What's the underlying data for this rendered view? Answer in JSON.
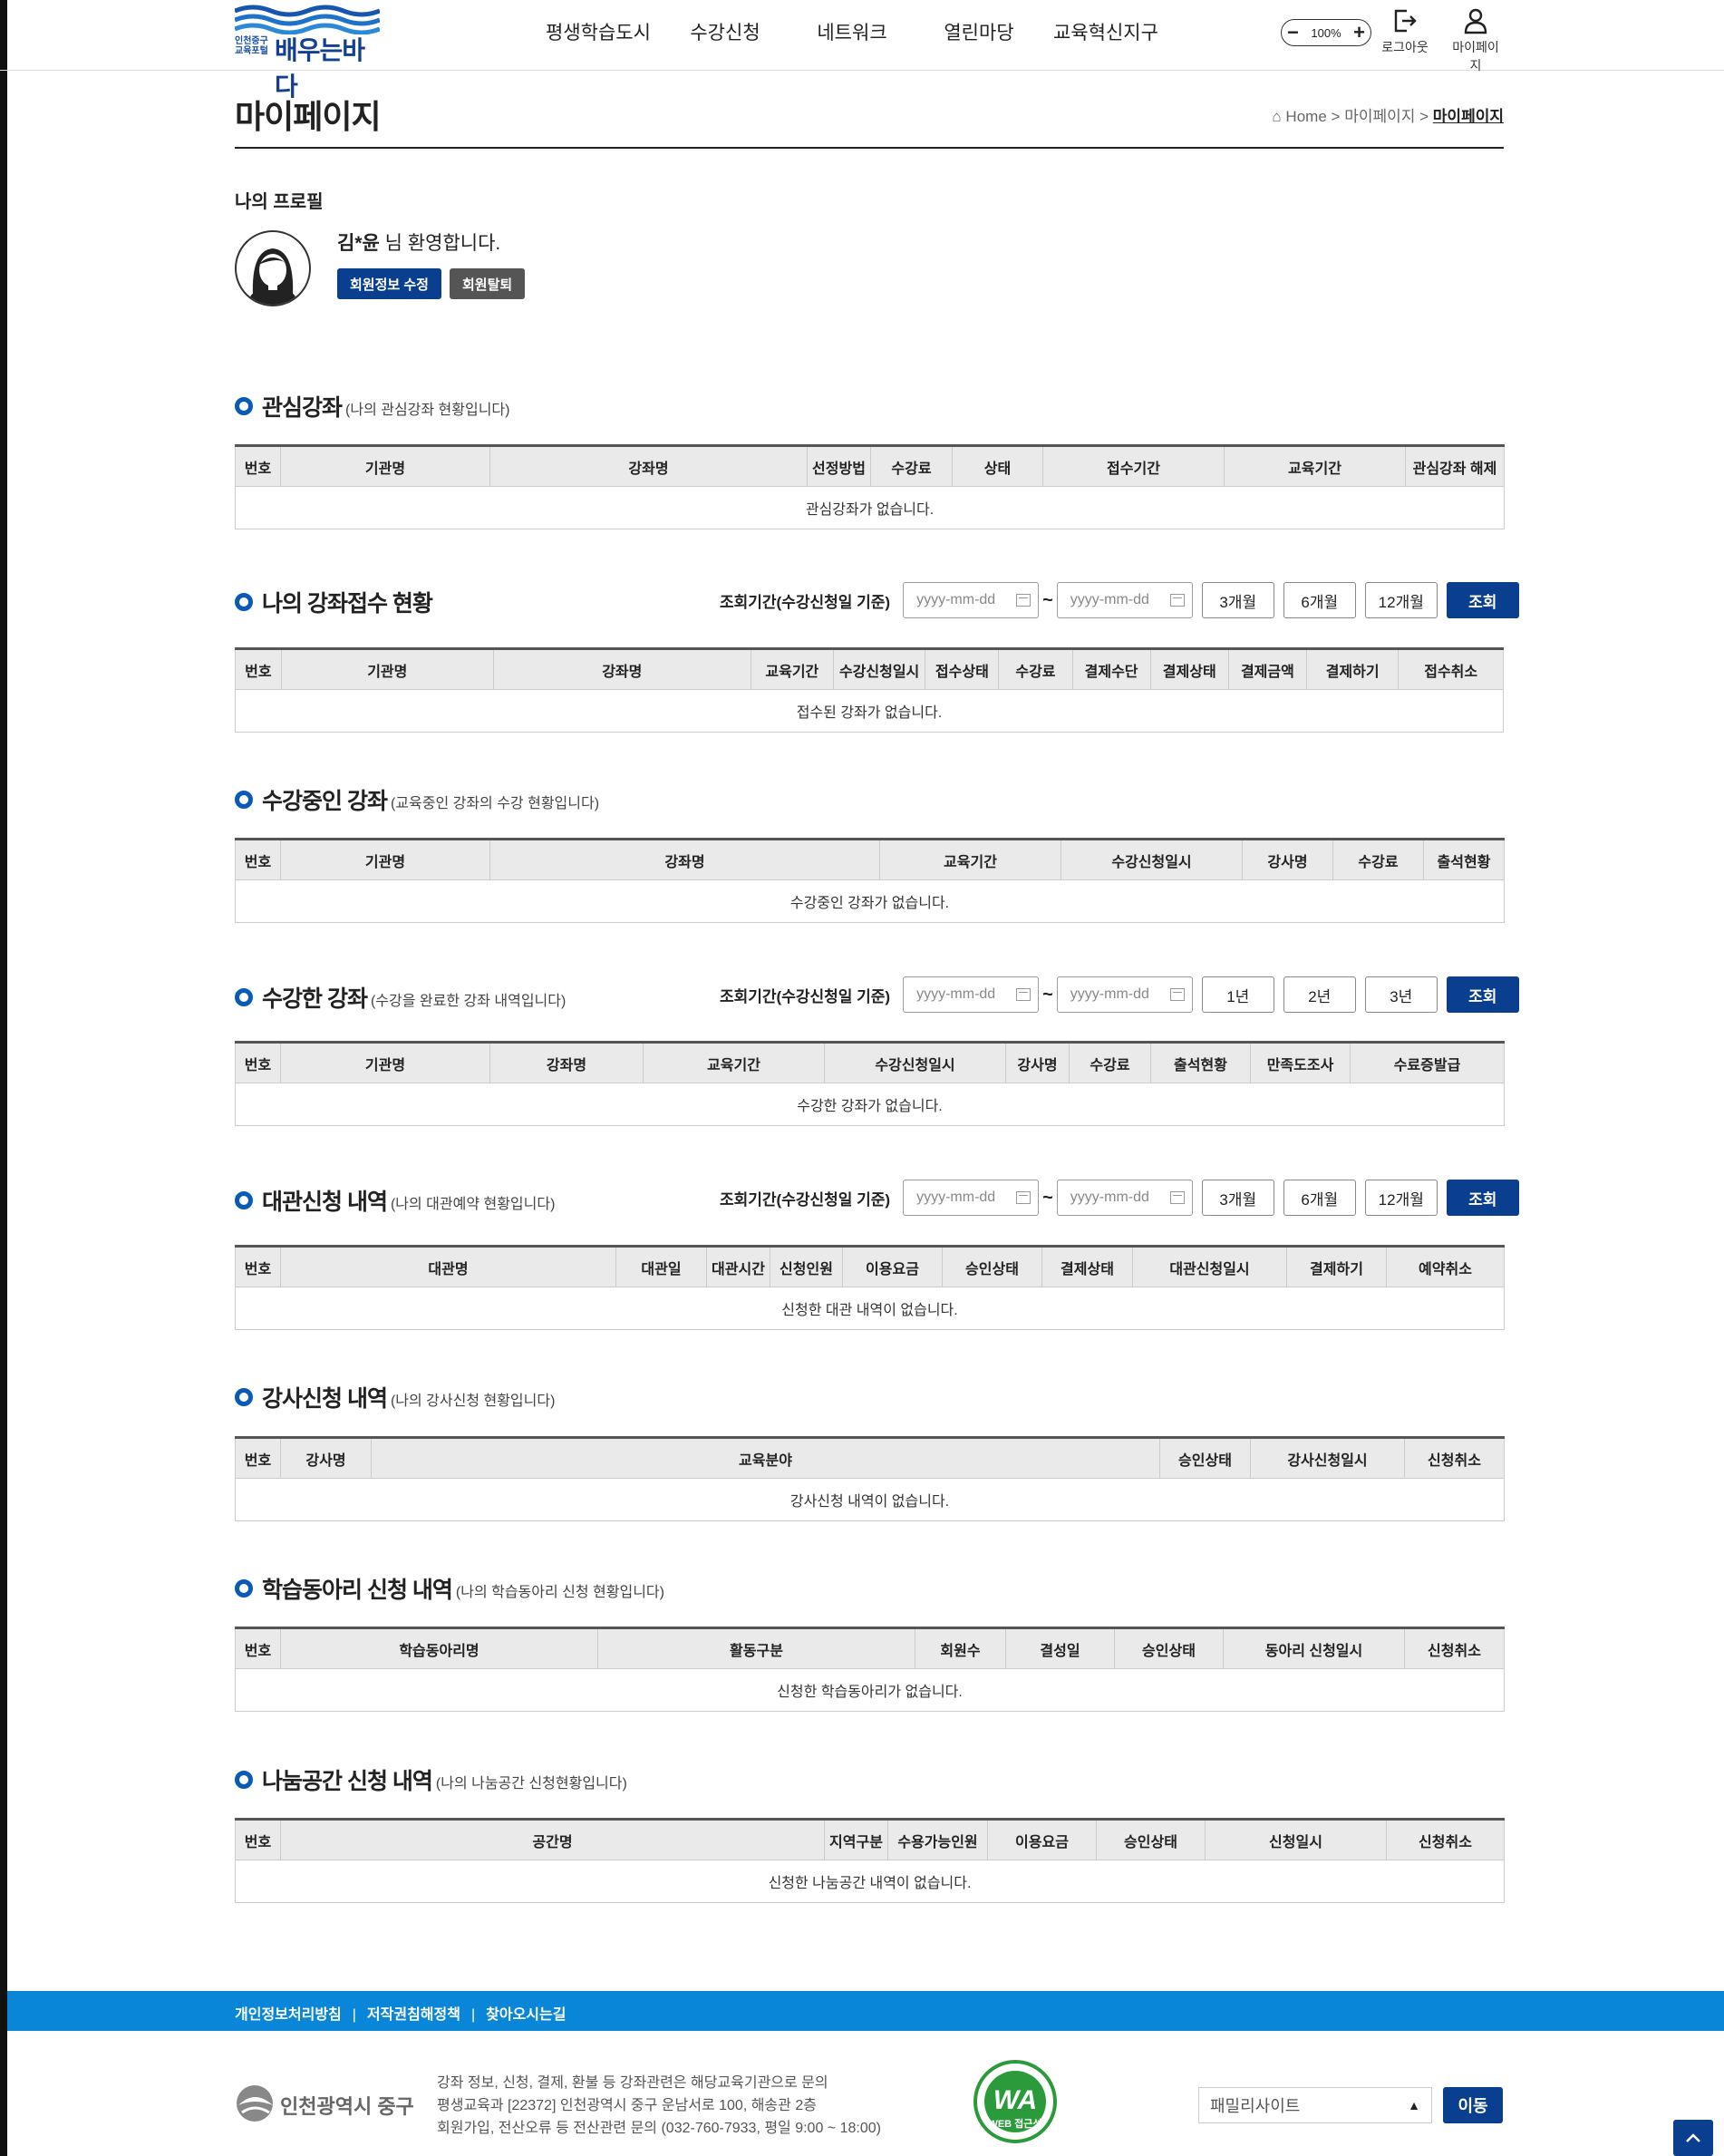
{
  "header": {
    "logo_small": "인천중구 교육포털",
    "logo_name": "배우는바다",
    "nav": [
      "평생학습도시",
      "수강신청",
      "네트워크",
      "열린마당",
      "교육혁신지구"
    ],
    "zoom_value": "100%",
    "logout_label": "로그아웃",
    "mypage_label": "마이페이지"
  },
  "page": {
    "title": "마이페이지",
    "breadcrumb_home": "Home",
    "breadcrumb_sep": ">",
    "breadcrumb_mid": "마이페이지",
    "breadcrumb_current": "마이페이지"
  },
  "profile": {
    "label": "나의 프로필",
    "name": "김*윤",
    "welcome_suffix": " 님 환영합니다.",
    "edit_button": "회원정보 수정",
    "withdraw_button": "회원탈퇴"
  },
  "search": {
    "label": "조회기간(수강신청일 기준)",
    "placeholder": "yyyy-mm-dd",
    "tilde": "~",
    "query_button": "조회"
  },
  "sections": [
    {
      "title": "관심강좌",
      "subtitle": "(나의 관심강좌 현황입니다)",
      "columns": [
        "번호",
        "기관명",
        "강좌명",
        "선정방법",
        "수강료",
        "상태",
        "접수기간",
        "교육기간",
        "관심강좌 해제"
      ],
      "empty": "관심강좌가 없습니다."
    },
    {
      "title": "나의 강좌접수 현황",
      "subtitle": "",
      "periods": [
        "3개월",
        "6개월",
        "12개월"
      ],
      "columns": [
        "번호",
        "기관명",
        "강좌명",
        "교육기간",
        "수강신청일시",
        "접수상태",
        "수강료",
        "결제수단",
        "결제상태",
        "결제금액",
        "결제하기",
        "접수취소"
      ],
      "empty": "접수된 강좌가 없습니다."
    },
    {
      "title": "수강중인 강좌",
      "subtitle": "(교육중인 강좌의 수강 현황입니다)",
      "columns": [
        "번호",
        "기관명",
        "강좌명",
        "교육기간",
        "수강신청일시",
        "강사명",
        "수강료",
        "출석현황"
      ],
      "empty": "수강중인 강좌가 없습니다."
    },
    {
      "title": "수강한 강좌",
      "subtitle": "(수강을 완료한 강좌 내역입니다)",
      "periods": [
        "1년",
        "2년",
        "3년"
      ],
      "columns": [
        "번호",
        "기관명",
        "강좌명",
        "교육기간",
        "수강신청일시",
        "강사명",
        "수강료",
        "출석현황",
        "만족도조사",
        "수료증발급"
      ],
      "empty": "수강한 강좌가 없습니다."
    },
    {
      "title": "대관신청 내역",
      "subtitle": "(나의 대관예약 현황입니다)",
      "periods": [
        "3개월",
        "6개월",
        "12개월"
      ],
      "columns": [
        "번호",
        "대관명",
        "대관일",
        "대관시간",
        "신청인원",
        "이용요금",
        "승인상태",
        "결제상태",
        "대관신청일시",
        "결제하기",
        "예약취소"
      ],
      "empty": "신청한 대관 내역이 없습니다."
    },
    {
      "title": "강사신청 내역",
      "subtitle": "(나의 강사신청 현황입니다)",
      "columns": [
        "번호",
        "강사명",
        "교육분야",
        "승인상태",
        "강사신청일시",
        "신청취소"
      ],
      "empty": "강사신청 내역이 없습니다."
    },
    {
      "title": "학습동아리 신청 내역",
      "subtitle": "(나의 학습동아리 신청 현황입니다)",
      "columns": [
        "번호",
        "학습동아리명",
        "활동구분",
        "회원수",
        "결성일",
        "승인상태",
        "동아리 신청일시",
        "신청취소"
      ],
      "empty": "신청한 학습동아리가 없습니다."
    },
    {
      "title": "나눔공간 신청 내역",
      "subtitle": "(나의 나눔공간 신청현황입니다)",
      "columns": [
        "번호",
        "공간명",
        "지역구분",
        "수용가능인원",
        "이용요금",
        "승인상태",
        "신청일시",
        "신청취소"
      ],
      "empty": "신청한 나눔공간 내역이 없습니다."
    }
  ],
  "footer": {
    "links": [
      "개인정보처리방침",
      "저작권침해정책",
      "찾아오시는길"
    ],
    "logo_text": "인천광역시 중구",
    "address_lines": [
      "강좌 정보, 신청, 결제, 환불 등 강좌관련은 해당교육기관으로 문의",
      "평생교육과 [22372] 인천광역시 중구 운남서로 100, 해송관 2층",
      "회원가입, 전산오류 등 전산관련 문의 (032-760-7933, 평일 9:00 ~ 18:00)"
    ],
    "wa_mark": "WA",
    "wa_caption": "WEB 접근성",
    "family_site": "패밀리사이트",
    "go_button": "이동"
  },
  "colors": {
    "primary": "#0a3f8f",
    "accent": "#0a86d8",
    "gray_button": "#555555"
  }
}
